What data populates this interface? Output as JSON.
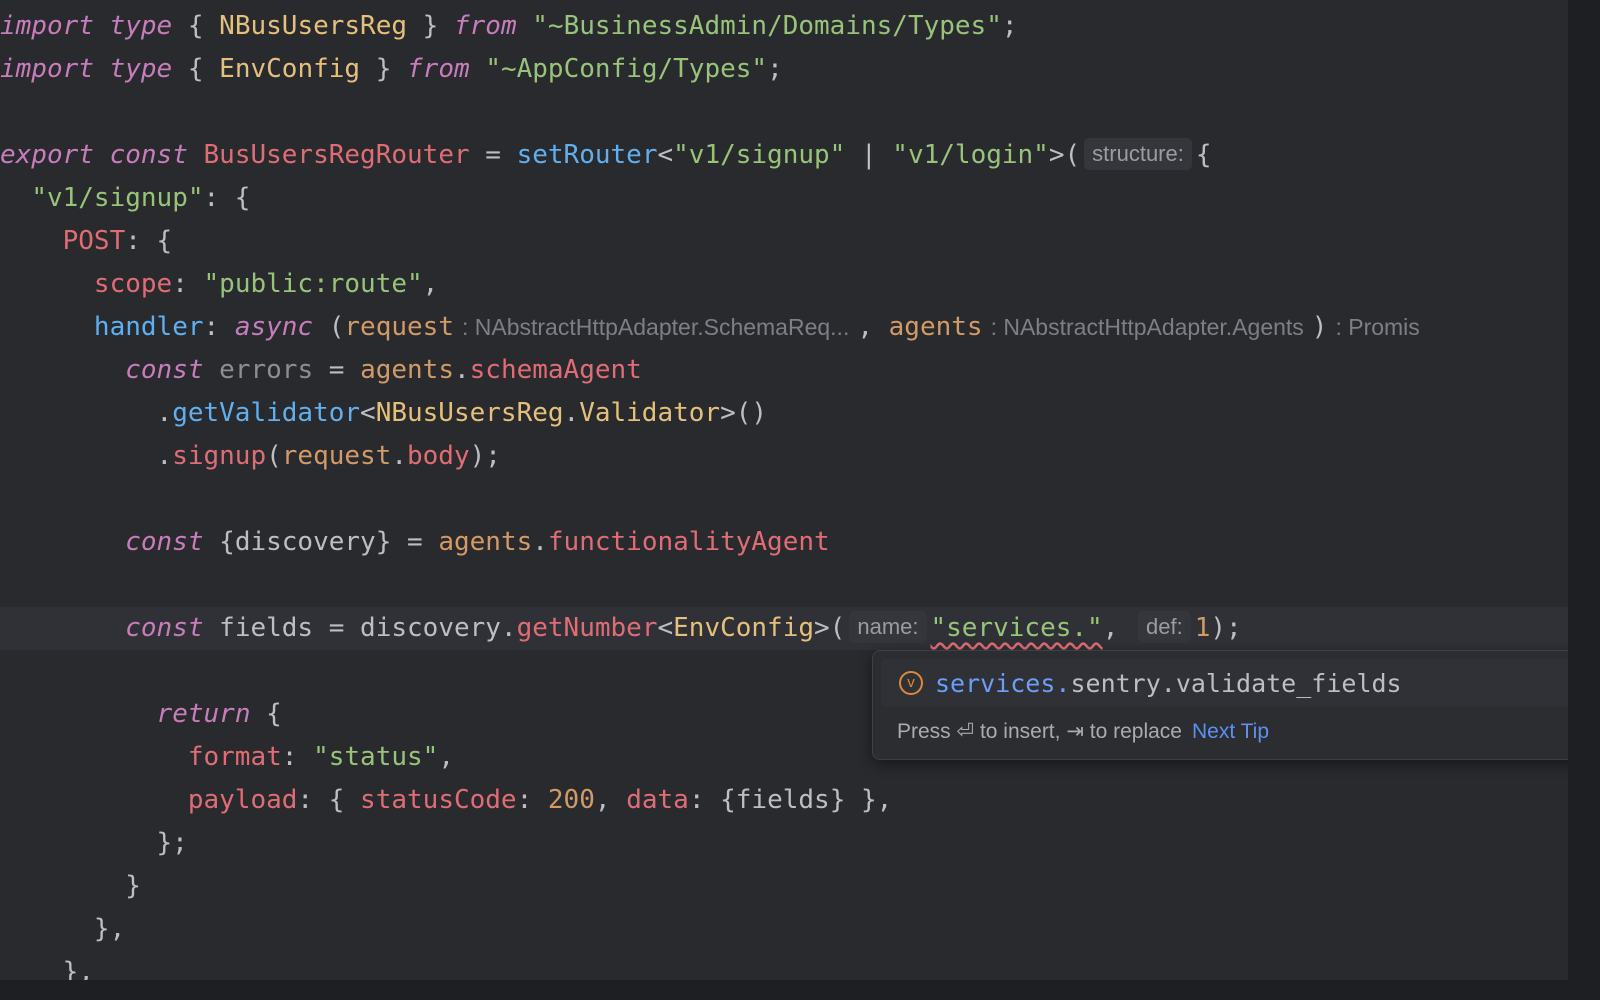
{
  "editor": {
    "lines": [
      {
        "tokens": [
          [
            "kw",
            "import"
          ],
          [
            "pln",
            " "
          ],
          [
            "kw",
            "type"
          ],
          [
            "pln",
            " { "
          ],
          [
            "type",
            "NBusUsersReg"
          ],
          [
            "pln",
            " } "
          ],
          [
            "kw",
            "from"
          ],
          [
            "pln",
            " "
          ],
          [
            "str",
            "\"~BusinessAdmin/Domains/Types\""
          ],
          [
            "pln",
            ";"
          ]
        ]
      },
      {
        "tokens": [
          [
            "kw",
            "import"
          ],
          [
            "pln",
            " "
          ],
          [
            "kw",
            "type"
          ],
          [
            "pln",
            " { "
          ],
          [
            "type",
            "EnvConfig"
          ],
          [
            "pln",
            " } "
          ],
          [
            "kw",
            "from"
          ],
          [
            "pln",
            " "
          ],
          [
            "str",
            "\"~AppConfig/Types\""
          ],
          [
            "pln",
            ";"
          ]
        ]
      },
      {
        "tokens": []
      },
      {
        "tokens": [
          [
            "kw",
            "export"
          ],
          [
            "pln",
            " "
          ],
          [
            "kw",
            "const"
          ],
          [
            "pln",
            " "
          ],
          [
            "prop",
            "BusUsersRegRouter"
          ],
          [
            "pln",
            " = "
          ],
          [
            "fn",
            "setRouter"
          ],
          [
            "pln",
            "<"
          ],
          [
            "str",
            "\"v1/signup\""
          ],
          [
            "pln",
            " | "
          ],
          [
            "str",
            "\"v1/login\""
          ],
          [
            "pln",
            ">("
          ],
          [
            "hint",
            "structure:"
          ],
          [
            "pln",
            "{"
          ]
        ]
      },
      {
        "tokens": [
          [
            "pln",
            "  "
          ],
          [
            "str",
            "\"v1/signup\""
          ],
          [
            "pln",
            ": {"
          ]
        ]
      },
      {
        "tokens": [
          [
            "pln",
            "    "
          ],
          [
            "prop",
            "POST"
          ],
          [
            "pln",
            ": {"
          ]
        ]
      },
      {
        "tokens": [
          [
            "pln",
            "      "
          ],
          [
            "prop",
            "scope"
          ],
          [
            "pln",
            ": "
          ],
          [
            "str",
            "\"public:route\""
          ],
          [
            "pln",
            ","
          ]
        ]
      },
      {
        "tokens": [
          [
            "pln",
            "      "
          ],
          [
            "fn",
            "handler"
          ],
          [
            "pln",
            ": "
          ],
          [
            "kw",
            "async"
          ],
          [
            "pln",
            " ("
          ],
          [
            "var",
            "request"
          ],
          [
            "hintp",
            ": NAbstractHttpAdapter.SchemaReq..."
          ],
          [
            "pln",
            ", "
          ],
          [
            "var",
            "agents"
          ],
          [
            "hintp",
            ": NAbstractHttpAdapter.Agents"
          ],
          [
            "pln",
            ")"
          ],
          [
            "hintp",
            ": Promis"
          ]
        ]
      },
      {
        "tokens": [
          [
            "pln",
            "        "
          ],
          [
            "kw",
            "const"
          ],
          [
            "pln",
            " "
          ],
          [
            "dim",
            "errors"
          ],
          [
            "pln",
            " = "
          ],
          [
            "var",
            "agents"
          ],
          [
            "pln",
            "."
          ],
          [
            "prop",
            "schemaAgent"
          ]
        ]
      },
      {
        "tokens": [
          [
            "pln",
            "          ."
          ],
          [
            "fn",
            "getValidator"
          ],
          [
            "pln",
            "<"
          ],
          [
            "type",
            "NBusUsersReg"
          ],
          [
            "pln",
            "."
          ],
          [
            "type",
            "Validator"
          ],
          [
            "pln",
            ">()"
          ]
        ]
      },
      {
        "tokens": [
          [
            "pln",
            "          ."
          ],
          [
            "prop",
            "signup"
          ],
          [
            "pln",
            "("
          ],
          [
            "var",
            "request"
          ],
          [
            "pln",
            "."
          ],
          [
            "prop",
            "body"
          ],
          [
            "pln",
            ");"
          ]
        ]
      },
      {
        "tokens": []
      },
      {
        "tokens": [
          [
            "pln",
            "        "
          ],
          [
            "kw",
            "const"
          ],
          [
            "pln",
            " {discovery} = "
          ],
          [
            "var",
            "agents"
          ],
          [
            "pln",
            "."
          ],
          [
            "prop",
            "functionalityAgent"
          ]
        ]
      },
      {
        "tokens": []
      },
      {
        "current": true,
        "tokens": [
          [
            "pln",
            "        "
          ],
          [
            "kw",
            "const"
          ],
          [
            "pln",
            " fields = discovery."
          ],
          [
            "prop",
            "getNumber"
          ],
          [
            "pln",
            "<"
          ],
          [
            "type",
            "EnvConfig"
          ],
          [
            "pln",
            ">("
          ],
          [
            "hint",
            "name:"
          ],
          [
            "err",
            "\"services.\""
          ],
          [
            "pln",
            ", "
          ],
          [
            "hint",
            "def:"
          ],
          [
            "num",
            "1"
          ],
          [
            "pln",
            ");"
          ]
        ]
      },
      {
        "tokens": []
      },
      {
        "tokens": [
          [
            "pln",
            "          "
          ],
          [
            "kw",
            "return"
          ],
          [
            "pln",
            " {"
          ]
        ]
      },
      {
        "tokens": [
          [
            "pln",
            "            "
          ],
          [
            "prop",
            "format"
          ],
          [
            "pln",
            ": "
          ],
          [
            "str",
            "\"status\""
          ],
          [
            "pln",
            ","
          ]
        ]
      },
      {
        "tokens": [
          [
            "pln",
            "            "
          ],
          [
            "prop",
            "payload"
          ],
          [
            "pln",
            ": { "
          ],
          [
            "prop",
            "statusCode"
          ],
          [
            "pln",
            ": "
          ],
          [
            "num",
            "200"
          ],
          [
            "pln",
            ", "
          ],
          [
            "prop",
            "data"
          ],
          [
            "pln",
            ": {fields} },"
          ]
        ]
      },
      {
        "tokens": [
          [
            "pln",
            "          };"
          ]
        ]
      },
      {
        "tokens": [
          [
            "pln",
            "        }"
          ]
        ]
      },
      {
        "tokens": [
          [
            "pln",
            "      },"
          ]
        ]
      },
      {
        "tokens": [
          [
            "pln",
            "    },"
          ]
        ]
      }
    ]
  },
  "completion": {
    "icon_letter": "v",
    "icon_name": "variable-icon",
    "match_text": "services.",
    "rest_text": "sentry.validate_fields",
    "footer_text": "Press ⏎ to insert, ⇥ to replace",
    "next_tip_label": "Next Tip"
  },
  "colors": {
    "background": "#282a2e",
    "keyword": "#c77dbb",
    "string": "#98c379",
    "type": "#e5c07b",
    "function": "#61afef",
    "property": "#e06c75",
    "variable": "#d19a66",
    "link": "#5f8ff0"
  }
}
